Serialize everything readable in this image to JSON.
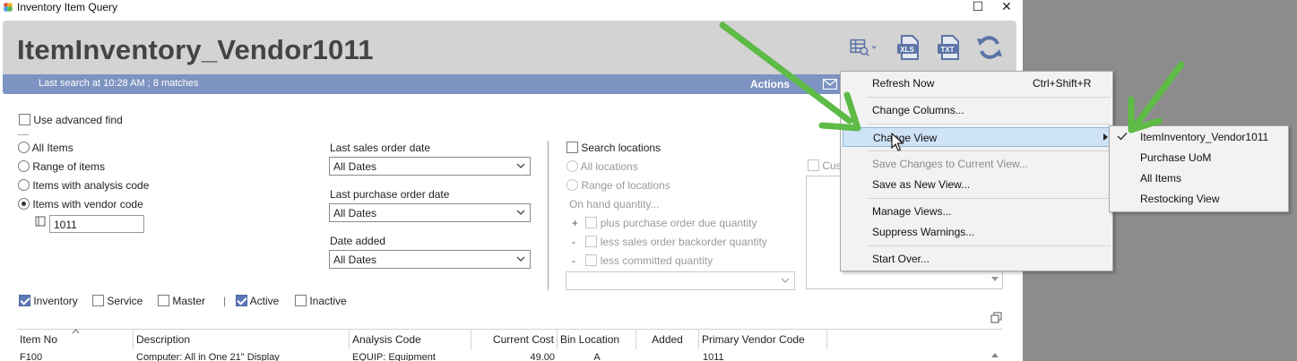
{
  "window": {
    "title": "Inventory Item Query",
    "maximize_glyph": "☐",
    "close_glyph": "✕"
  },
  "header": {
    "title": "ItemInventory_Vendor1011",
    "icons": [
      "grid-search-icon",
      "xls-export-icon",
      "txt-export-icon",
      "refresh-icon"
    ],
    "xls_label": "XLS",
    "txt_label": "TXT"
  },
  "statusbar": {
    "text": "Last search at 10:28 AM ; 8 matches",
    "actions_label": "Actions"
  },
  "filters": {
    "advanced_find_label": "Use advanced find",
    "item_scope": {
      "options": [
        "All Items",
        "Range of items",
        "Items with analysis code",
        "Items with vendor code"
      ],
      "selected": "Items with vendor code"
    },
    "vendor_code_value": "1011",
    "last_sales_order_date": {
      "label": "Last sales order date",
      "value": "All Dates"
    },
    "last_purchase_order_date": {
      "label": "Last purchase order date",
      "value": "All Dates"
    },
    "date_added": {
      "label": "Date added",
      "value": "All Dates"
    },
    "search_locations": {
      "label": "Search locations",
      "all_locations": "All locations",
      "range_of_locations": "Range of locations",
      "on_hand_label": "On hand quantity...",
      "plus_sign": "+",
      "minus_sign": "-",
      "plus_purchase": "plus purchase order due quantity",
      "less_sales": "less sales order backorder quantity",
      "less_committed": "less committed quantity",
      "location_select_value": ""
    },
    "custom_label": "Cus",
    "item_types": [
      {
        "label": "Inventory",
        "checked": true
      },
      {
        "label": "Service",
        "checked": false
      },
      {
        "label": "Master",
        "checked": false
      },
      {
        "label": "Active",
        "checked": true
      },
      {
        "label": "Inactive",
        "checked": false
      }
    ],
    "type_separator": "|"
  },
  "grid": {
    "columns": [
      "Item No",
      "Description",
      "Analysis Code",
      "Current Cost",
      "Bin Location",
      "Added",
      "Primary Vendor Code"
    ],
    "rows": [
      [
        "F100",
        "Computer: All in One 21\" Display",
        "EQUIP: Equipment",
        "49.00",
        "A",
        "",
        "1011"
      ]
    ]
  },
  "context_menu": {
    "items": [
      {
        "label": "Refresh Now",
        "shortcut": "Ctrl+Shift+R",
        "enabled": true
      },
      {
        "label": "Change Columns...",
        "enabled": true
      },
      {
        "label": "Change View",
        "enabled": true,
        "submenu": true,
        "highlighted": true
      },
      {
        "label": "Save Changes to Current View...",
        "enabled": false
      },
      {
        "label": "Save as New View...",
        "enabled": true
      },
      {
        "label": "Manage Views...",
        "enabled": true
      },
      {
        "label": "Suppress Warnings...",
        "enabled": true
      },
      {
        "label": "Start Over...",
        "enabled": true
      }
    ]
  },
  "view_submenu": {
    "items": [
      {
        "label": "ItemInventory_Vendor1011",
        "checked": true
      },
      {
        "label": "Purchase UoM",
        "checked": false
      },
      {
        "label": "All Items",
        "checked": false
      },
      {
        "label": "Restocking View",
        "checked": false
      }
    ]
  },
  "colors": {
    "header_bg": "#d3d3d3",
    "statusbar_bg": "#7d93c1",
    "menu_highlight": "#cfe3f7",
    "annotation_arrow": "#5dbb46",
    "checkbox_checked": "#5b78b8"
  }
}
